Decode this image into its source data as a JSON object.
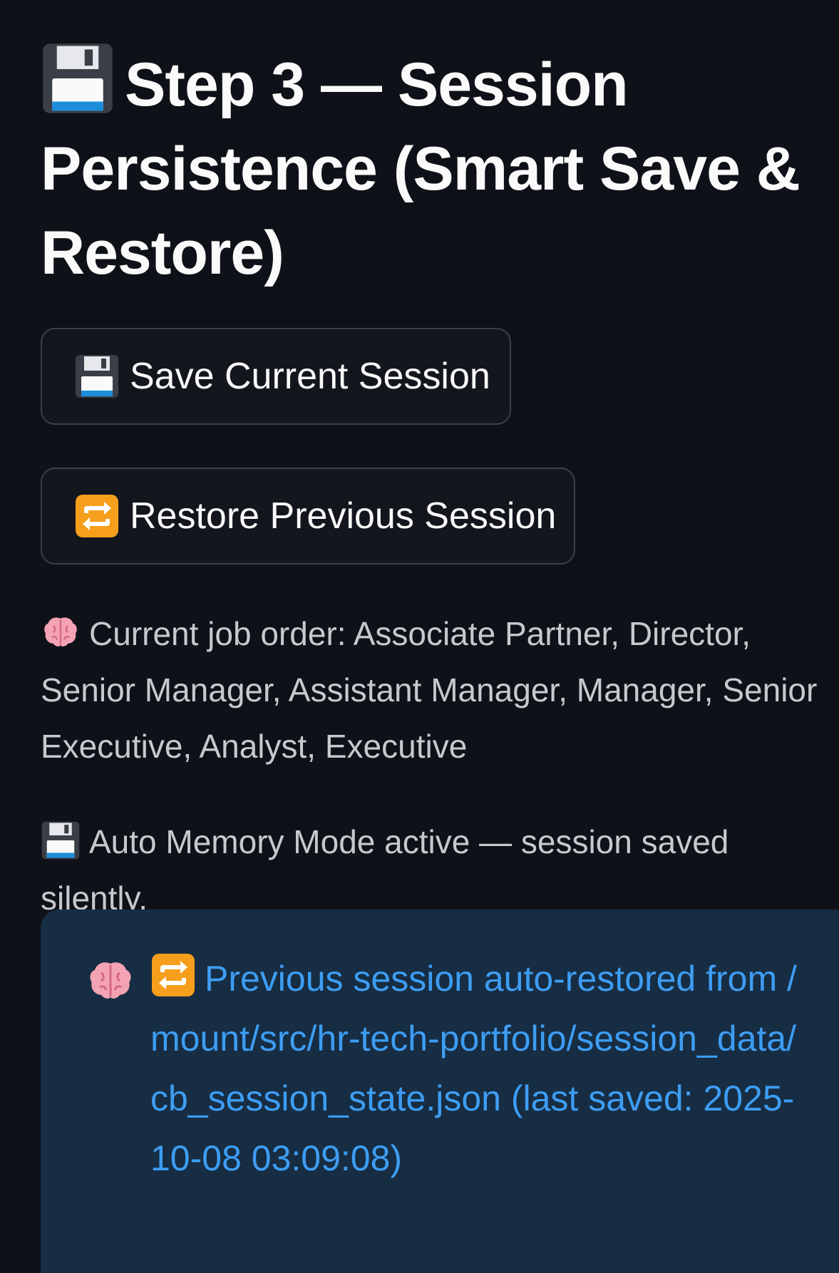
{
  "header": {
    "title_icon": "floppy-disk-icon",
    "title": "Step 3 — Session Persistence (Smart Save & Restore)"
  },
  "buttons": {
    "save": {
      "icon": "floppy-disk-icon",
      "label": "Save Current Session"
    },
    "restore": {
      "icon": "repeat-arrows-icon",
      "label": "Restore Previous Session"
    }
  },
  "status": {
    "job_order_icon": "brain-icon",
    "job_order_text": "Current job order: Associate Partner, Director, Senior Manager, Assistant Manager, Manager, Senior Executive, Analyst, Executive",
    "auto_memory_icon": "floppy-disk-icon",
    "auto_memory_text": "Auto Memory Mode active — session saved silently."
  },
  "info_box": {
    "icons": [
      "brain-icon",
      "repeat-arrows-icon"
    ],
    "message": "Previous session auto-restored from /mount/src/hr-tech-portfolio/session_data/cb_session_state.json (last saved: 2025-10-08 03:09:08)"
  },
  "colors": {
    "background": "#0e1117",
    "info_box_bg": "#172d43",
    "info_text": "#3d9df3",
    "button_border": "#3d4049"
  }
}
